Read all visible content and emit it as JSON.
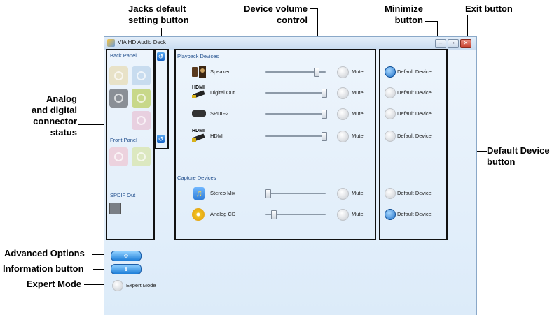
{
  "callouts": {
    "jacks_default": [
      "Jacks default",
      "setting button"
    ],
    "device_volume": [
      "Device volume",
      "control"
    ],
    "minimize": [
      "Minimize",
      "button"
    ],
    "exit": "Exit button",
    "analog_status": [
      "Analog",
      "and digital",
      "connector",
      "status"
    ],
    "default_device": [
      "Default Device",
      "button"
    ],
    "advanced_options": "Advanced Options",
    "information": "Information button",
    "expert_mode": "Expert Mode"
  },
  "window": {
    "title": "VIA HD Audio Deck",
    "minimize_glyph": "–",
    "maximize_glyph": "▫",
    "close_glyph": "✕"
  },
  "left_panel": {
    "back_panel": "Back Panel",
    "front_panel": "Front Panel",
    "spdif_out": "SPDIF Out"
  },
  "playback": {
    "heading": "Playback Devices",
    "devices": [
      {
        "name": "Speaker",
        "volume": 0.86,
        "mute": "Mute",
        "default_label": "Default Device",
        "is_default": true
      },
      {
        "name": "Digital Out",
        "volume": 1.0,
        "mute": "Mute",
        "default_label": "Default Device",
        "is_default": false
      },
      {
        "name": "SPDIF2",
        "volume": 1.0,
        "mute": "Mute",
        "default_label": "Default Device",
        "is_default": false
      },
      {
        "name": "HDMI",
        "volume": 1.0,
        "mute": "Mute",
        "default_label": "Default Device",
        "is_default": false
      }
    ]
  },
  "capture": {
    "heading": "Capture Devices",
    "devices": [
      {
        "name": "Stereo Mix",
        "volume": 0.0,
        "mute": "Mute",
        "default_label": "Default Device",
        "is_default": false
      },
      {
        "name": "Analog CD",
        "volume": 0.1,
        "mute": "Mute",
        "default_label": "Default Device",
        "is_default": true
      }
    ]
  },
  "hdmi_badge": "HDMI",
  "bottom": {
    "expert_mode_label": "Expert Mode"
  },
  "colors": {
    "accent": "#1d6fc8",
    "jack_pink": "#e8c8d8",
    "jack_green": "#c8d88a",
    "jack_blue": "#b8d0e8",
    "jack_gray": "#8a8f96"
  }
}
